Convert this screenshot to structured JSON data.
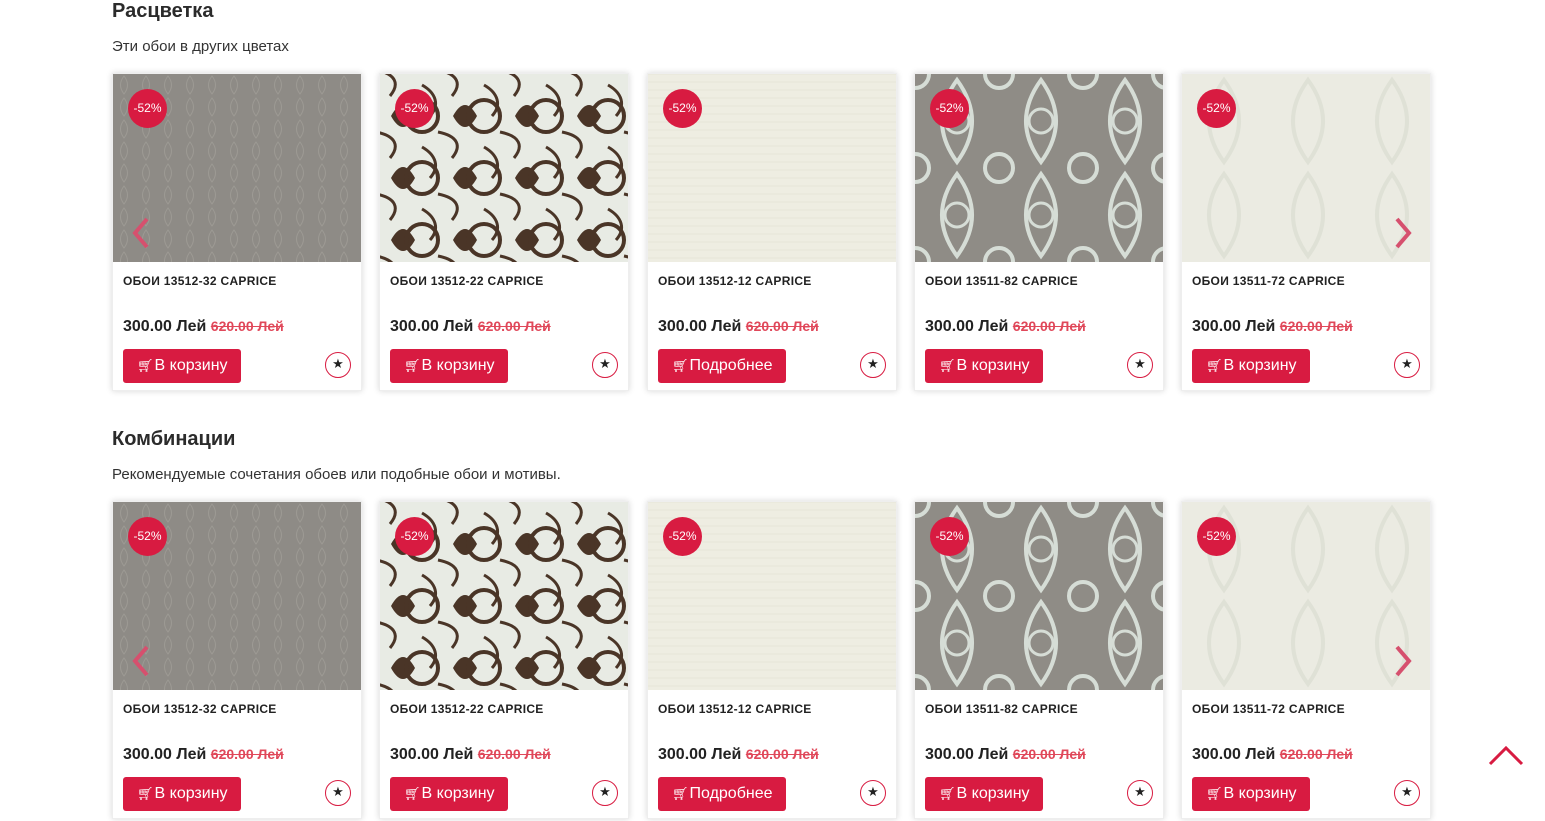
{
  "sections": [
    {
      "title": "Расцветка",
      "subtitle": "Эти обои в других цветах",
      "products": [
        {
          "name": "ОБОИ 13512-32 CAPRICE",
          "badge": "-52%",
          "price": "300.00 Лей",
          "old_price": "620.00 Лей",
          "button": "В корзину",
          "pattern": "grey-damask"
        },
        {
          "name": "ОБОИ 13512-22 CAPRICE",
          "badge": "-52%",
          "price": "300.00 Лей",
          "old_price": "620.00 Лей",
          "button": "В корзину",
          "pattern": "brown-swirl"
        },
        {
          "name": "ОБОИ 13512-12 CAPRICE",
          "badge": "-52%",
          "price": "300.00 Лей",
          "old_price": "620.00 Лей",
          "button": "Подробнее",
          "pattern": "cream-plain"
        },
        {
          "name": "ОБОИ 13511-82 CAPRICE",
          "badge": "-52%",
          "price": "300.00 Лей",
          "old_price": "620.00 Лей",
          "button": "В корзину",
          "pattern": "grey-ornament"
        },
        {
          "name": "ОБОИ 13511-72 CAPRICE",
          "badge": "-52%",
          "price": "300.00 Лей",
          "old_price": "620.00 Лей",
          "button": "В корзину",
          "pattern": "light-damask"
        }
      ]
    },
    {
      "title": "Комбинации",
      "subtitle": "Рекомендуемые сочетания обоев или подобные обои и мотивы.",
      "products": [
        {
          "name": "ОБОИ 13512-32 CAPRICE",
          "badge": "-52%",
          "price": "300.00 Лей",
          "old_price": "620.00 Лей",
          "button": "В корзину",
          "pattern": "grey-damask"
        },
        {
          "name": "ОБОИ 13512-22 CAPRICE",
          "badge": "-52%",
          "price": "300.00 Лей",
          "old_price": "620.00 Лей",
          "button": "В корзину",
          "pattern": "brown-swirl"
        },
        {
          "name": "ОБОИ 13512-12 CAPRICE",
          "badge": "-52%",
          "price": "300.00 Лей",
          "old_price": "620.00 Лей",
          "button": "Подробнее",
          "pattern": "cream-plain"
        },
        {
          "name": "ОБОИ 13511-82 CAPRICE",
          "badge": "-52%",
          "price": "300.00 Лей",
          "old_price": "620.00 Лей",
          "button": "В корзину",
          "pattern": "grey-ornament"
        },
        {
          "name": "ОБОИ 13511-72 CAPRICE",
          "badge": "-52%",
          "price": "300.00 Лей",
          "old_price": "620.00 Лей",
          "button": "В корзину",
          "pattern": "light-damask"
        }
      ]
    }
  ],
  "icons": {
    "cart": "cart-icon",
    "favorite": "star-icon",
    "prev": "chevron-left-icon",
    "next": "chevron-right-icon",
    "scroll_top": "chevron-up-icon"
  },
  "colors": {
    "accent": "#d81b41",
    "old_price": "#e0485a",
    "text": "#222222"
  }
}
